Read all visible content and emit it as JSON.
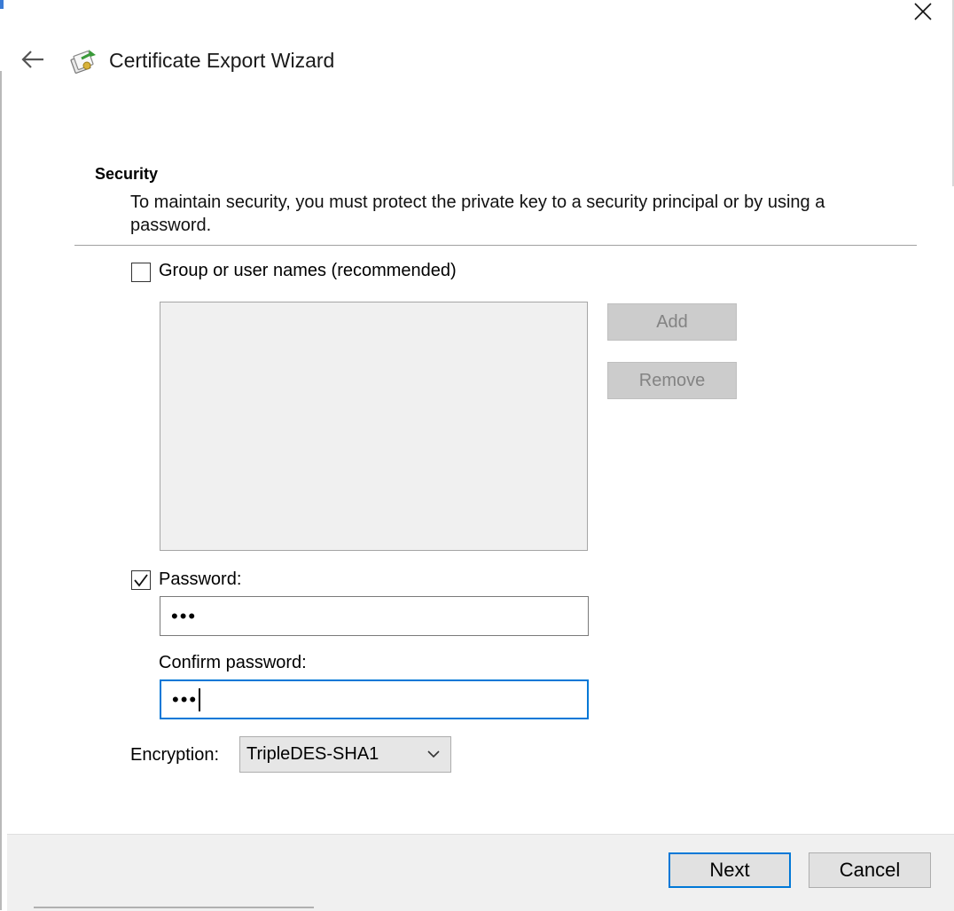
{
  "window": {
    "title": "Certificate Export Wizard",
    "close_icon": "close-icon",
    "back_icon": "back-arrow-icon",
    "app_icon": "certificate-wizard-icon"
  },
  "security": {
    "heading": "Security",
    "description": "To maintain security, you must protect the private key to a security principal or by using a password."
  },
  "groups": {
    "checkbox_label": "Group or user names (recommended)",
    "checked": false,
    "add_label": "Add",
    "remove_label": "Remove"
  },
  "password": {
    "checkbox_label": "Password:",
    "checked": true,
    "value": "•••",
    "confirm_label": "Confirm password:",
    "confirm_value": "•••"
  },
  "encryption": {
    "label": "Encryption:",
    "selected": "TripleDES-SHA1"
  },
  "footer": {
    "next_label": "Next",
    "cancel_label": "Cancel"
  },
  "colors": {
    "accent": "#0078d7",
    "disabled_button": "#cccccc",
    "footer_bg": "#f0f0f0"
  }
}
